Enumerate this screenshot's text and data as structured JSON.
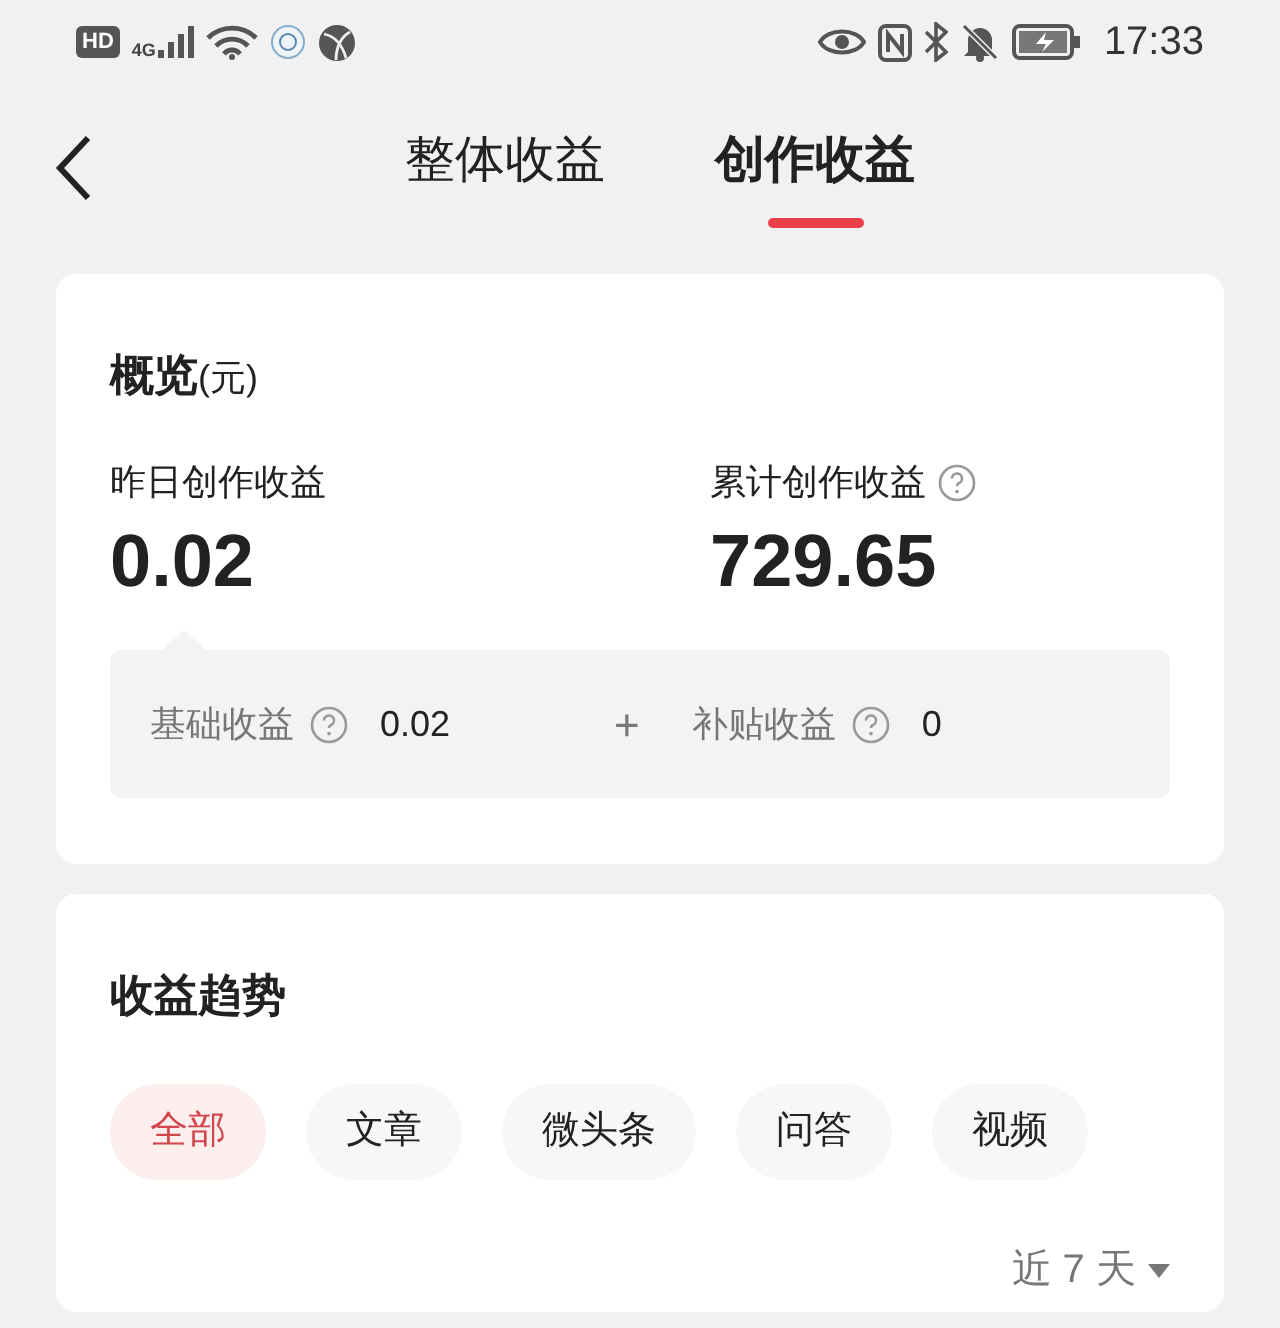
{
  "status_bar": {
    "network": [
      "HD",
      "4G"
    ],
    "time": "17:33"
  },
  "header": {
    "tabs": [
      {
        "label": "整体收益",
        "selected": false
      },
      {
        "label": "创作收益",
        "selected": true
      }
    ]
  },
  "overview": {
    "title": "概览",
    "unit": "(元)",
    "stats": [
      {
        "label": "昨日创作收益",
        "value": "0.02",
        "help": false
      },
      {
        "label": "累计创作收益",
        "value": "729.65",
        "help": true
      }
    ],
    "breakdown": [
      {
        "label": "基础收益",
        "value": "0.02"
      },
      {
        "label": "补贴收益",
        "value": "0"
      }
    ],
    "operator": "+"
  },
  "trend": {
    "title": "收益趋势",
    "filters": [
      {
        "label": "全部",
        "selected": true
      },
      {
        "label": "文章",
        "selected": false
      },
      {
        "label": "微头条",
        "selected": false
      },
      {
        "label": "问答",
        "selected": false
      },
      {
        "label": "视频",
        "selected": false
      }
    ],
    "range": "近 7 天"
  }
}
